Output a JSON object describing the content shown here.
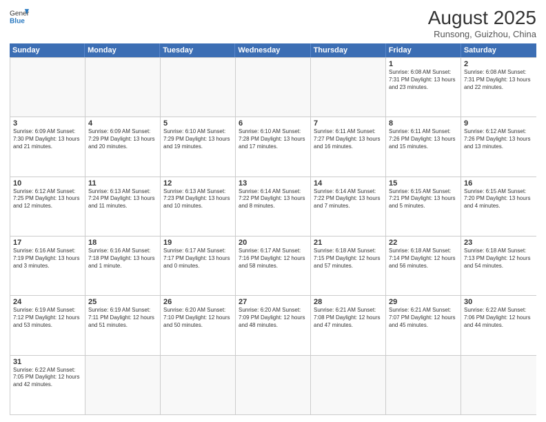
{
  "header": {
    "logo_general": "General",
    "logo_blue": "Blue",
    "month_year": "August 2025",
    "location": "Runsong, Guizhou, China"
  },
  "days_of_week": [
    "Sunday",
    "Monday",
    "Tuesday",
    "Wednesday",
    "Thursday",
    "Friday",
    "Saturday"
  ],
  "weeks": [
    [
      {
        "day": "",
        "info": ""
      },
      {
        "day": "",
        "info": ""
      },
      {
        "day": "",
        "info": ""
      },
      {
        "day": "",
        "info": ""
      },
      {
        "day": "",
        "info": ""
      },
      {
        "day": "1",
        "info": "Sunrise: 6:08 AM\nSunset: 7:31 PM\nDaylight: 13 hours and 23 minutes."
      },
      {
        "day": "2",
        "info": "Sunrise: 6:08 AM\nSunset: 7:31 PM\nDaylight: 13 hours and 22 minutes."
      }
    ],
    [
      {
        "day": "3",
        "info": "Sunrise: 6:09 AM\nSunset: 7:30 PM\nDaylight: 13 hours and 21 minutes."
      },
      {
        "day": "4",
        "info": "Sunrise: 6:09 AM\nSunset: 7:29 PM\nDaylight: 13 hours and 20 minutes."
      },
      {
        "day": "5",
        "info": "Sunrise: 6:10 AM\nSunset: 7:29 PM\nDaylight: 13 hours and 19 minutes."
      },
      {
        "day": "6",
        "info": "Sunrise: 6:10 AM\nSunset: 7:28 PM\nDaylight: 13 hours and 17 minutes."
      },
      {
        "day": "7",
        "info": "Sunrise: 6:11 AM\nSunset: 7:27 PM\nDaylight: 13 hours and 16 minutes."
      },
      {
        "day": "8",
        "info": "Sunrise: 6:11 AM\nSunset: 7:26 PM\nDaylight: 13 hours and 15 minutes."
      },
      {
        "day": "9",
        "info": "Sunrise: 6:12 AM\nSunset: 7:26 PM\nDaylight: 13 hours and 13 minutes."
      }
    ],
    [
      {
        "day": "10",
        "info": "Sunrise: 6:12 AM\nSunset: 7:25 PM\nDaylight: 13 hours and 12 minutes."
      },
      {
        "day": "11",
        "info": "Sunrise: 6:13 AM\nSunset: 7:24 PM\nDaylight: 13 hours and 11 minutes."
      },
      {
        "day": "12",
        "info": "Sunrise: 6:13 AM\nSunset: 7:23 PM\nDaylight: 13 hours and 10 minutes."
      },
      {
        "day": "13",
        "info": "Sunrise: 6:14 AM\nSunset: 7:22 PM\nDaylight: 13 hours and 8 minutes."
      },
      {
        "day": "14",
        "info": "Sunrise: 6:14 AM\nSunset: 7:22 PM\nDaylight: 13 hours and 7 minutes."
      },
      {
        "day": "15",
        "info": "Sunrise: 6:15 AM\nSunset: 7:21 PM\nDaylight: 13 hours and 5 minutes."
      },
      {
        "day": "16",
        "info": "Sunrise: 6:15 AM\nSunset: 7:20 PM\nDaylight: 13 hours and 4 minutes."
      }
    ],
    [
      {
        "day": "17",
        "info": "Sunrise: 6:16 AM\nSunset: 7:19 PM\nDaylight: 13 hours and 3 minutes."
      },
      {
        "day": "18",
        "info": "Sunrise: 6:16 AM\nSunset: 7:18 PM\nDaylight: 13 hours and 1 minute."
      },
      {
        "day": "19",
        "info": "Sunrise: 6:17 AM\nSunset: 7:17 PM\nDaylight: 13 hours and 0 minutes."
      },
      {
        "day": "20",
        "info": "Sunrise: 6:17 AM\nSunset: 7:16 PM\nDaylight: 12 hours and 58 minutes."
      },
      {
        "day": "21",
        "info": "Sunrise: 6:18 AM\nSunset: 7:15 PM\nDaylight: 12 hours and 57 minutes."
      },
      {
        "day": "22",
        "info": "Sunrise: 6:18 AM\nSunset: 7:14 PM\nDaylight: 12 hours and 56 minutes."
      },
      {
        "day": "23",
        "info": "Sunrise: 6:18 AM\nSunset: 7:13 PM\nDaylight: 12 hours and 54 minutes."
      }
    ],
    [
      {
        "day": "24",
        "info": "Sunrise: 6:19 AM\nSunset: 7:12 PM\nDaylight: 12 hours and 53 minutes."
      },
      {
        "day": "25",
        "info": "Sunrise: 6:19 AM\nSunset: 7:11 PM\nDaylight: 12 hours and 51 minutes."
      },
      {
        "day": "26",
        "info": "Sunrise: 6:20 AM\nSunset: 7:10 PM\nDaylight: 12 hours and 50 minutes."
      },
      {
        "day": "27",
        "info": "Sunrise: 6:20 AM\nSunset: 7:09 PM\nDaylight: 12 hours and 48 minutes."
      },
      {
        "day": "28",
        "info": "Sunrise: 6:21 AM\nSunset: 7:08 PM\nDaylight: 12 hours and 47 minutes."
      },
      {
        "day": "29",
        "info": "Sunrise: 6:21 AM\nSunset: 7:07 PM\nDaylight: 12 hours and 45 minutes."
      },
      {
        "day": "30",
        "info": "Sunrise: 6:22 AM\nSunset: 7:06 PM\nDaylight: 12 hours and 44 minutes."
      }
    ],
    [
      {
        "day": "31",
        "info": "Sunrise: 6:22 AM\nSunset: 7:05 PM\nDaylight: 12 hours and 42 minutes."
      },
      {
        "day": "",
        "info": ""
      },
      {
        "day": "",
        "info": ""
      },
      {
        "day": "",
        "info": ""
      },
      {
        "day": "",
        "info": ""
      },
      {
        "day": "",
        "info": ""
      },
      {
        "day": "",
        "info": ""
      }
    ]
  ]
}
